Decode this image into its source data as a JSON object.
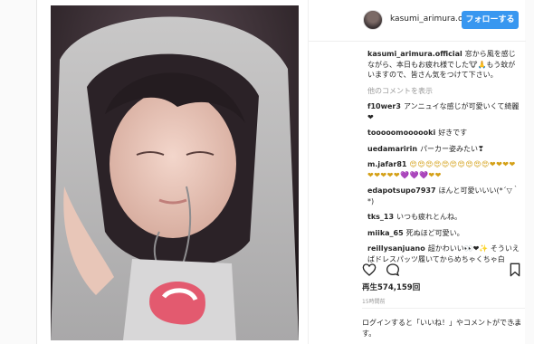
{
  "header": {
    "username": "kasumi_arimura.of",
    "follow_label": "フォローする"
  },
  "caption": {
    "username": "kasumi_arimura.official",
    "text": "窓から風を感じながら、本日もお疲れ様でした🐮🙏もう蚊がいますので、皆さん気をつけて下さい。"
  },
  "more_comments_label": "他のコメントを表示",
  "comments": [
    {
      "username": "f10wer3",
      "text": "アンニュイな感じが可愛いくて綺麗❤"
    },
    {
      "username": "tooooomoooooki",
      "text": "好きです"
    },
    {
      "username": "uedamaririn",
      "text": "パーカー姿みたい❣"
    },
    {
      "username": "m.jafar81",
      "text": "😍😍😍😍😍😍😍😍😍😍❤❤❤❤❤❤❤❤❤💜💜💜❤❤"
    },
    {
      "username": "edapotsupo7937",
      "text": "ほんと可愛いいい(*´▽｀*)"
    },
    {
      "username": "tks_13",
      "text": "いつも疲れとんね。"
    },
    {
      "username": "miika_65",
      "text": "死ぬほど可愛い。"
    },
    {
      "username": "reillysanjuano",
      "text": "超かわいい👀❤✨ そういえばドレスパッツ履いてからめちゃくちゃ白"
    }
  ],
  "views": "再生574,159回",
  "timestamp": "15時間前",
  "login_note": "ログインすると「いいね！」やコメントができます。",
  "icons": {
    "like": "heart-icon",
    "comment": "speech-bubble-icon",
    "bookmark": "bookmark-icon",
    "more": "more-dots-icon"
  }
}
